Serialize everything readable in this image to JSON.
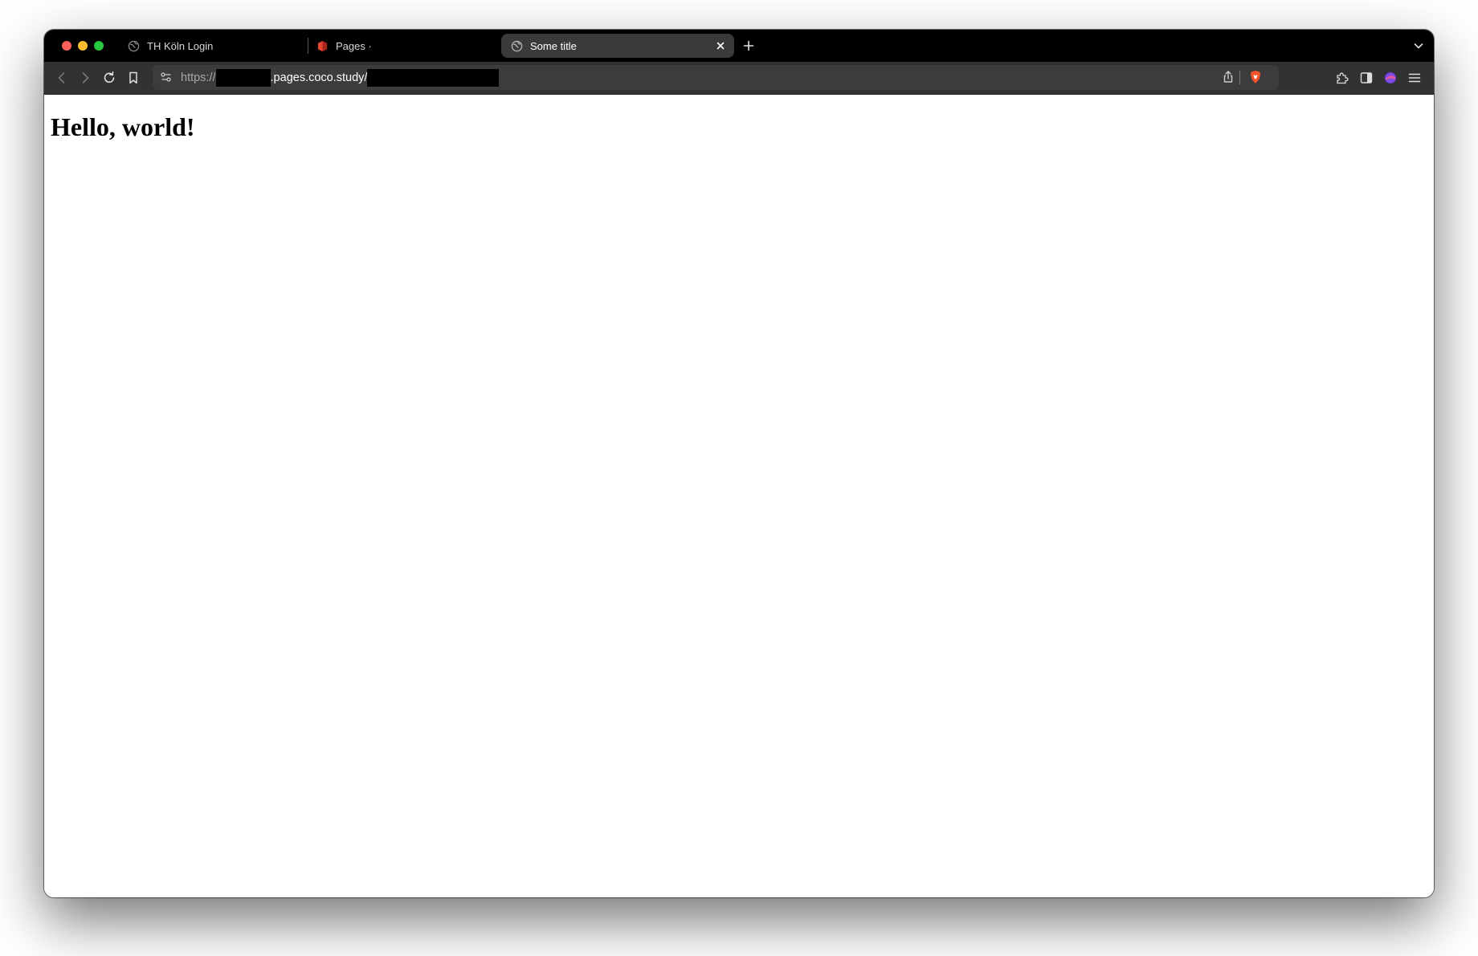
{
  "browser": {
    "tabs": [
      {
        "title": "TH Köln Login",
        "favicon": "globe-icon",
        "active": false
      },
      {
        "title": "Pages ·",
        "favicon": "pages-logo-icon",
        "active": false
      },
      {
        "title": "Some title",
        "favicon": "globe-icon",
        "active": true
      }
    ],
    "address_bar": {
      "scheme": "https://",
      "host": ".pages.coco.study/"
    },
    "colors": {
      "tabstrip_bg": "#000000",
      "toolbar_bg": "#323232",
      "active_tab_bg": "#3a3a3a",
      "brave_orange": "#fb542b"
    }
  },
  "page": {
    "heading": "Hello, world!"
  }
}
